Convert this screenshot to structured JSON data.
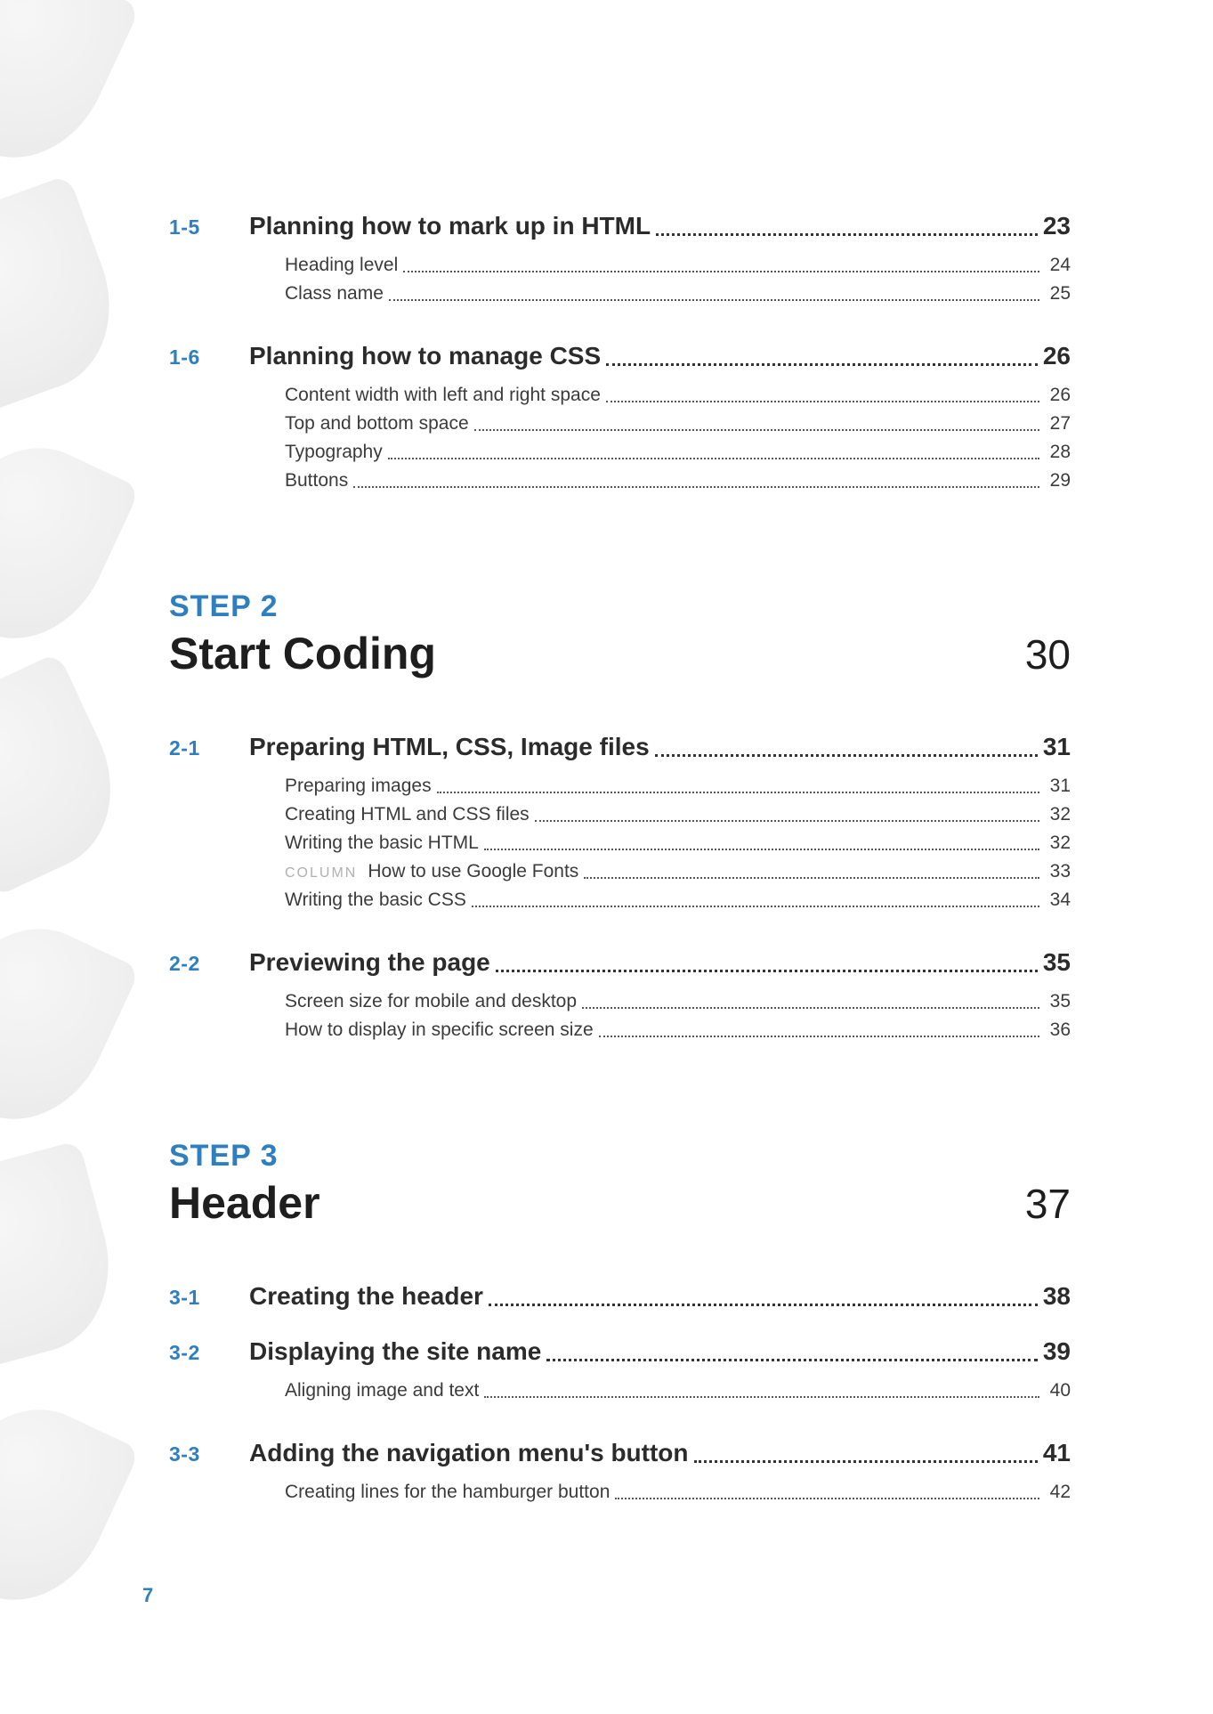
{
  "pageNumber": "7",
  "preSections": [
    {
      "num": "1-5",
      "title": "Planning how to mark up in HTML",
      "page": "23",
      "subs": [
        {
          "title": "Heading level",
          "page": "24"
        },
        {
          "title": "Class name",
          "page": "25"
        }
      ]
    },
    {
      "num": "1-6",
      "title": "Planning how to manage CSS",
      "page": "26",
      "subs": [
        {
          "title": "Content width with left and right space",
          "page": "26"
        },
        {
          "title": "Top and bottom space",
          "page": "27"
        },
        {
          "title": "Typography",
          "page": "28"
        },
        {
          "title": "Buttons",
          "page": "29"
        }
      ]
    }
  ],
  "steps": [
    {
      "label": "STEP 2",
      "title": "Start Coding",
      "page": "30",
      "sections": [
        {
          "num": "2-1",
          "title": "Preparing HTML, CSS, Image files",
          "page": "31",
          "subs": [
            {
              "title": "Preparing images",
              "page": "31"
            },
            {
              "title": "Creating HTML and CSS files",
              "page": "32"
            },
            {
              "title": "Writing the basic HTML",
              "page": "32"
            },
            {
              "prefix": "COLUMN",
              "title": "How to use Google Fonts",
              "page": "33"
            },
            {
              "title": "Writing the basic CSS",
              "page": "34"
            }
          ]
        },
        {
          "num": "2-2",
          "title": "Previewing the page",
          "page": "35",
          "subs": [
            {
              "title": "Screen size for mobile and desktop",
              "page": "35"
            },
            {
              "title": "How to display in specific screen size",
              "page": "36"
            }
          ]
        }
      ]
    },
    {
      "label": "STEP 3",
      "title": "Header",
      "page": "37",
      "sections": [
        {
          "num": "3-1",
          "title": "Creating the header",
          "page": "38",
          "subs": []
        },
        {
          "num": "3-2",
          "title": "Displaying the site name",
          "page": "39",
          "subs": [
            {
              "title": "Aligning image and text",
              "page": "40"
            }
          ]
        },
        {
          "num": "3-3",
          "title": "Adding the navigation menu's button",
          "page": "41",
          "subs": [
            {
              "title": "Creating lines for the hamburger button",
              "page": "42"
            }
          ]
        }
      ]
    }
  ]
}
